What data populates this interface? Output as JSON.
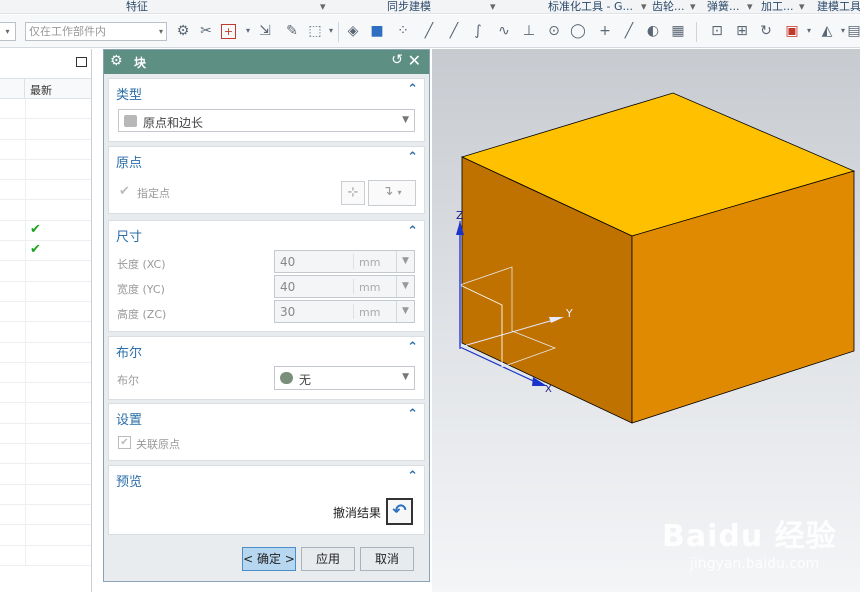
{
  "menu_groups": [
    "特征",
    "同步建模",
    "标准化工具 - G...",
    "齿轮...",
    "弹簧...",
    "加工...",
    "建模工具"
  ],
  "toolbar": {
    "filter_value": "仅在工作部件内"
  },
  "navigator": {
    "column_header": "最新",
    "checked_rows": [
      6,
      7
    ],
    "row_count": 23
  },
  "dialog": {
    "title": "块",
    "sections": {
      "type": {
        "title": "类型",
        "value": "原点和边长"
      },
      "origin": {
        "title": "原点",
        "label": "指定点"
      },
      "dimensions": {
        "title": "尺寸",
        "length_label": "长度 (XC)",
        "length_value": "40",
        "width_label": "宽度 (YC)",
        "width_value": "40",
        "height_label": "高度 (ZC)",
        "height_value": "30",
        "unit": "mm"
      },
      "boolean": {
        "title": "布尔",
        "label": "布尔",
        "value": "无"
      },
      "settings": {
        "title": "设置",
        "checkbox_label": "关联原点"
      },
      "preview": {
        "title": "预览",
        "undo_label": "撤消结果"
      }
    },
    "buttons": {
      "ok": "< 确定 >",
      "apply": "应用",
      "cancel": "取消"
    }
  },
  "viewport": {
    "axis_z": "Z",
    "axis_y": "Y",
    "axis_x": "X",
    "colors": {
      "top": "#FFC000",
      "front": "#BF7200",
      "right": "#DF8A00"
    }
  },
  "watermark": {
    "brand": "Baidu 经验",
    "url": "jingyan.baidu.com"
  }
}
